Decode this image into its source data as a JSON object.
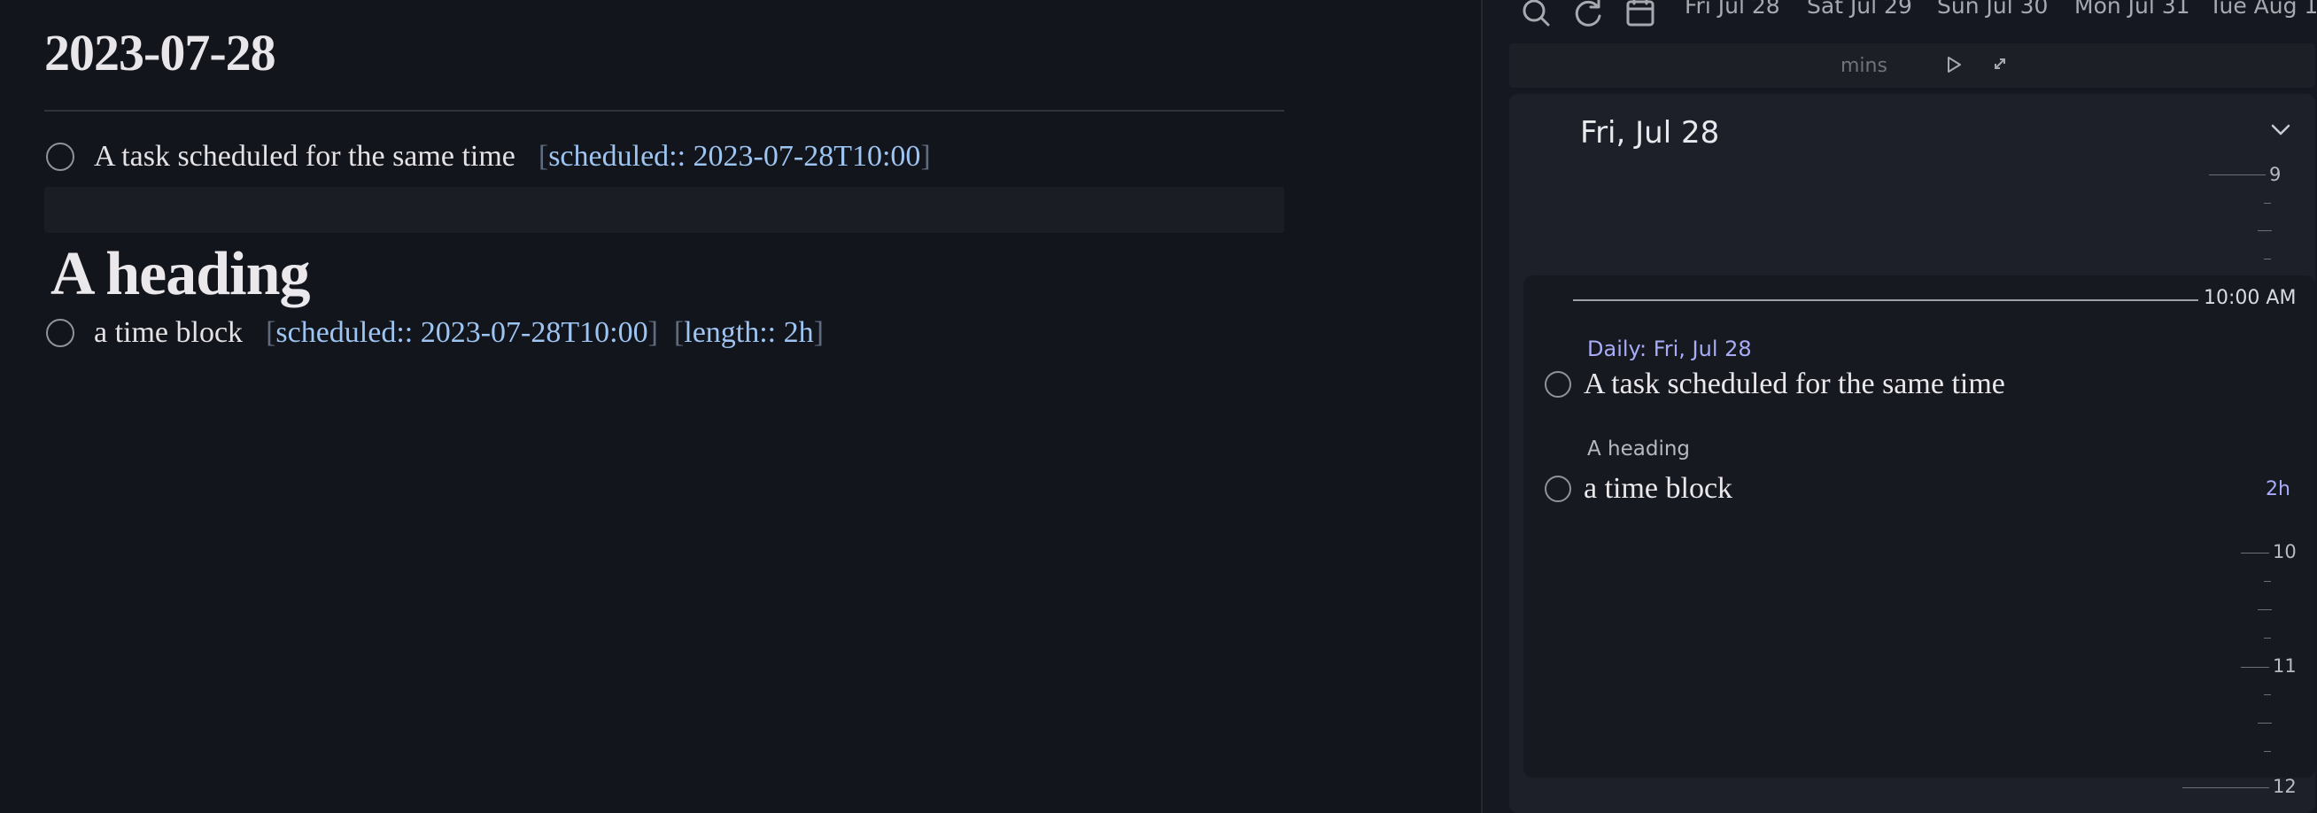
{
  "editor": {
    "note_title": "2023-07-28",
    "task1": {
      "text": "A task scheduled for the same time",
      "scheduled_prop": "scheduled:: 2023-07-28T10:00"
    },
    "heading": "A heading",
    "task2": {
      "text": "a time block",
      "scheduled_prop": "scheduled:: 2023-07-28T10:00",
      "length_prop": "length:: 2h"
    }
  },
  "planner": {
    "toolbar": {
      "icons": [
        "search-icon",
        "refresh-icon",
        "calendar-icon"
      ],
      "days": [
        "Fri Jul 28",
        "Sat Jul 29",
        "Sun Jul 30",
        "Mon Jul 31",
        "Tue Aug 1"
      ]
    },
    "controls": {
      "mins_label": "mins",
      "icons": [
        "play-icon",
        "expand-icon"
      ]
    },
    "day_column": {
      "title": "Fri, Jul 28",
      "hours": [
        "9",
        "10",
        "11",
        "12"
      ],
      "now_label": "10:00 AM",
      "block": {
        "source": "Daily: Fri, Jul 28",
        "task1": "A task scheduled for the same time",
        "heading": "A heading",
        "task2": "a time block",
        "length": "2h"
      }
    }
  },
  "colors": {
    "background": "#12151b",
    "property_value": "#9ec4f2",
    "accent": "#a8acf7"
  }
}
